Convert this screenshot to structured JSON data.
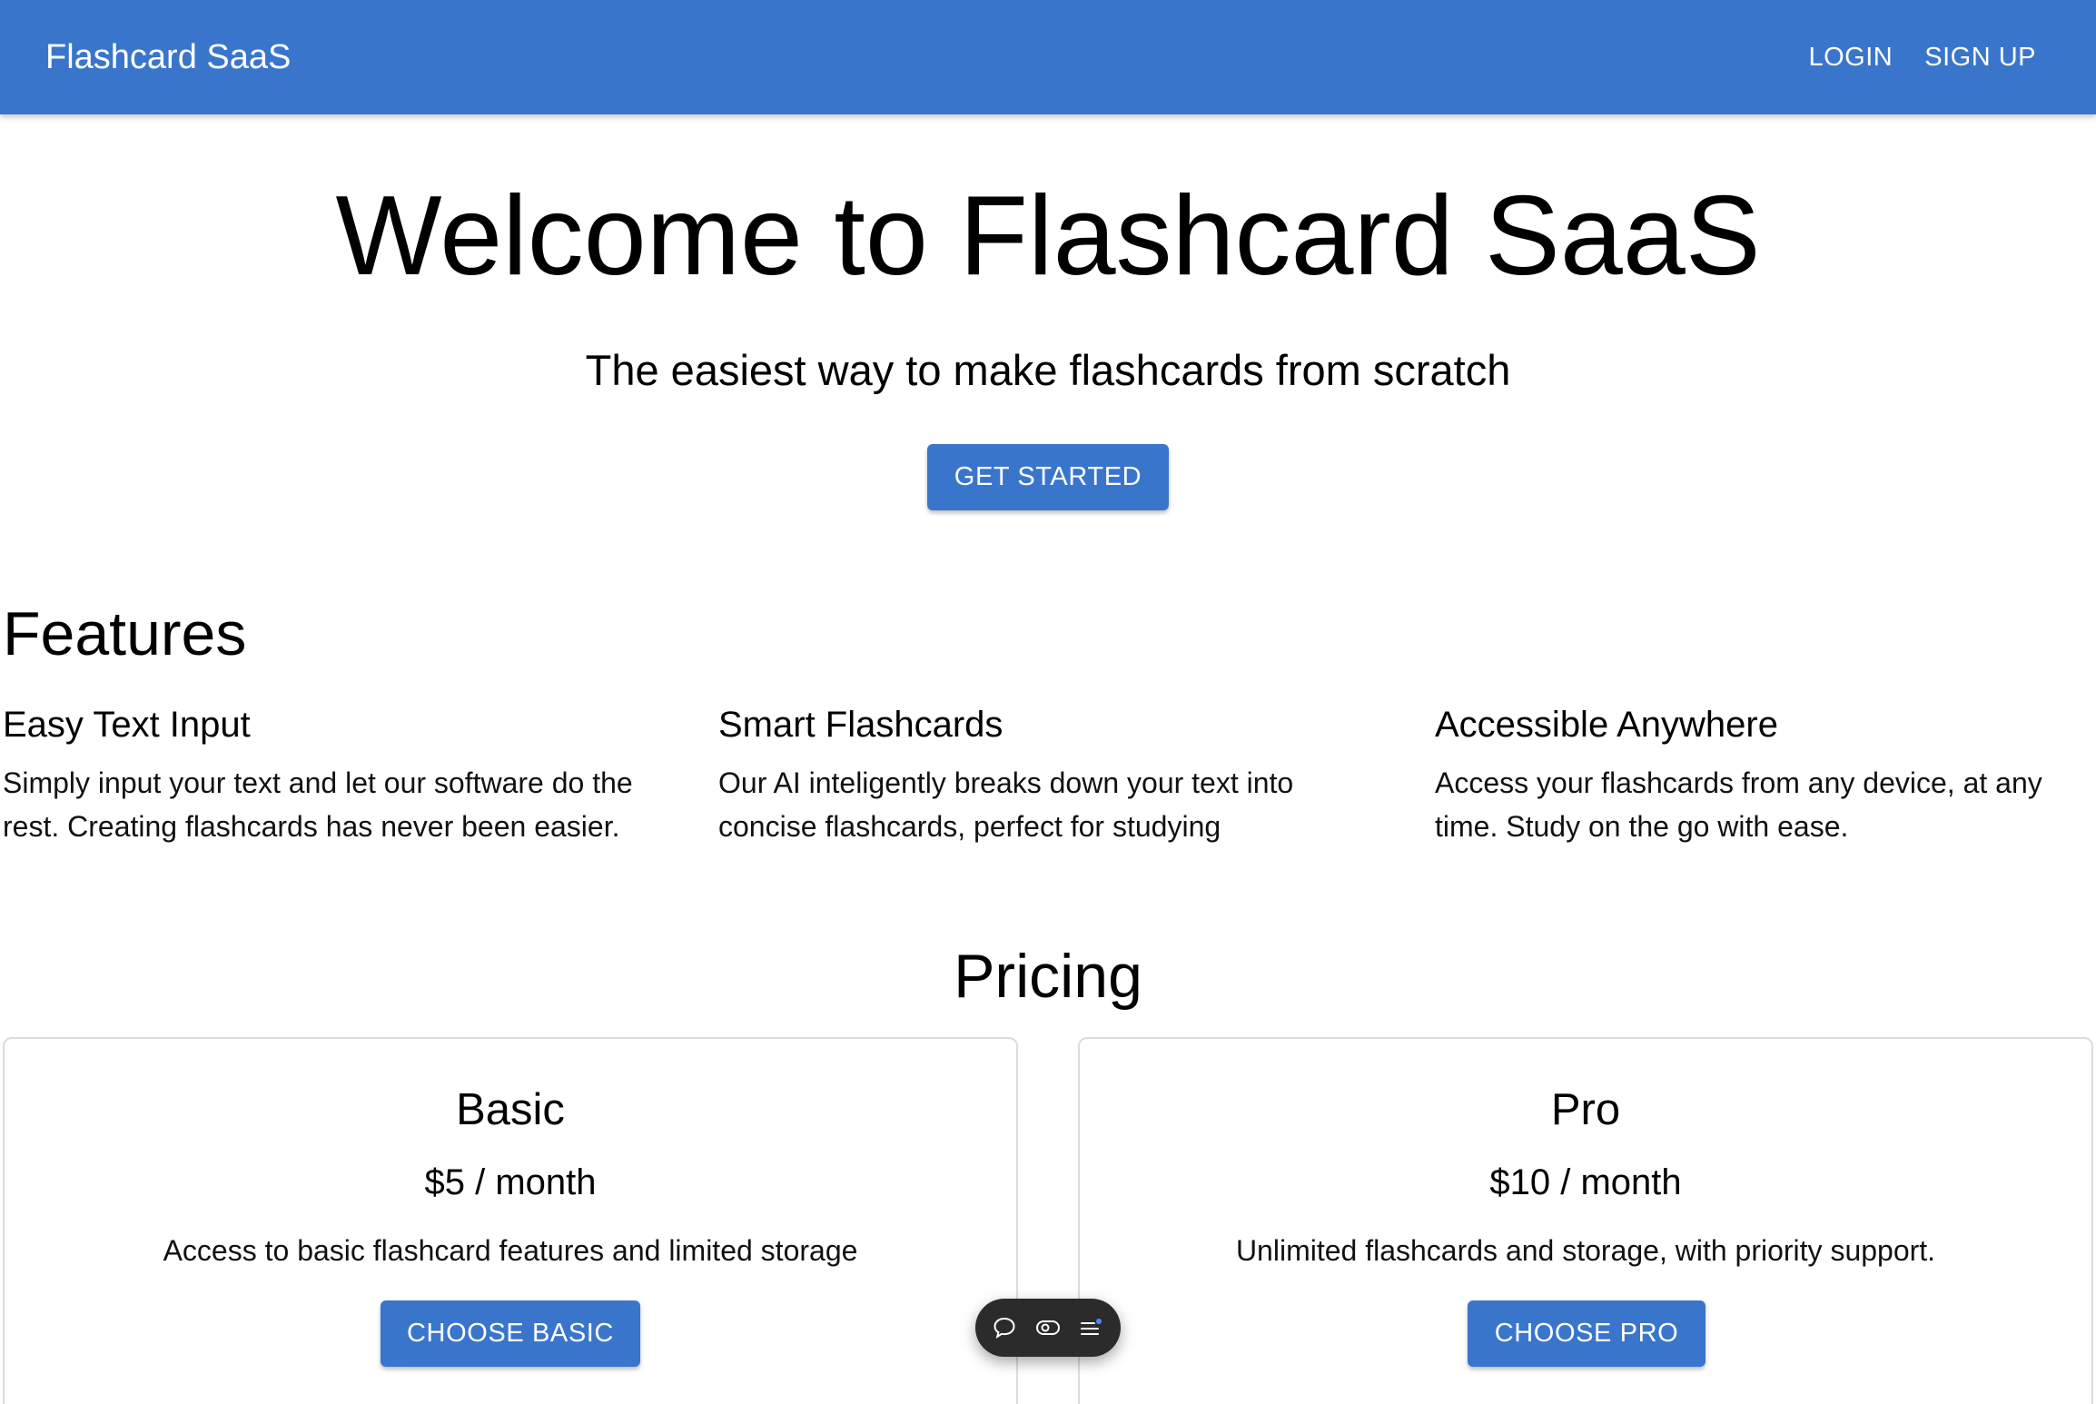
{
  "appbar": {
    "brand": "Flashcard SaaS",
    "nav": {
      "login": "LOGIN",
      "signup": "SIGN UP"
    },
    "background_color": "#3a75cc"
  },
  "hero": {
    "title": "Welcome to Flashcard SaaS",
    "subtitle": "The easiest way to make flashcards from scratch",
    "cta_label": "GET STARTED"
  },
  "features": {
    "title": "Features",
    "items": [
      {
        "title": "Easy Text Input",
        "description": "Simply input your text and let our software do the rest. Creating flashcards has never been easier."
      },
      {
        "title": "Smart Flashcards",
        "description": "Our AI inteligently breaks down your text into concise flashcards, perfect for studying"
      },
      {
        "title": "Accessible Anywhere",
        "description": "Access your flashcards from any device, at any time. Study on the go with ease."
      }
    ]
  },
  "pricing": {
    "title": "Pricing",
    "plans": [
      {
        "name": "Basic",
        "price": "$5 / month",
        "description": "Access to basic flashcard features and limited storage",
        "button_label": "CHOOSE BASIC"
      },
      {
        "name": "Pro",
        "price": "$10 / month",
        "description": "Unlimited flashcards and storage, with priority support.",
        "button_label": "CHOOSE PRO"
      }
    ]
  },
  "floating_toolbar": {
    "icons": [
      "chat-bubble-icon",
      "toggle-icon",
      "menu-list-icon"
    ],
    "accent_dot_color": "#4a8cf7"
  }
}
